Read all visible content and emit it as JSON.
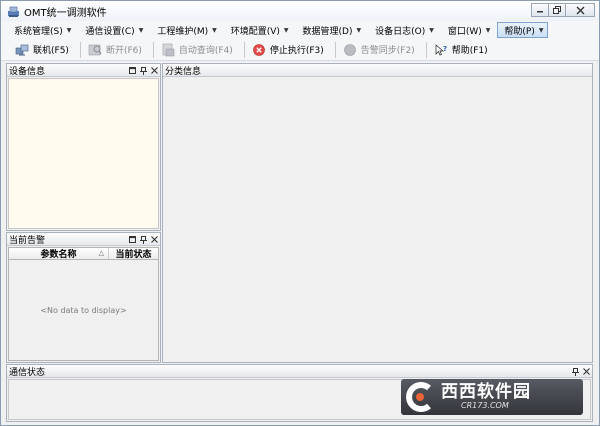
{
  "window": {
    "title": "OMT统一调测软件"
  },
  "menu": [
    {
      "label": "系统管理(S)",
      "active": false
    },
    {
      "label": "通信设置(C)",
      "active": false
    },
    {
      "label": "工程维护(M)",
      "active": false
    },
    {
      "label": "环境配置(V)",
      "active": false
    },
    {
      "label": "数据管理(D)",
      "active": false
    },
    {
      "label": "设备日志(O)",
      "active": false
    },
    {
      "label": "窗口(W)",
      "active": false
    },
    {
      "label": "帮助(P)",
      "active": true
    }
  ],
  "toolbar": {
    "connect": "联机(F5)",
    "disconnect": "断开(F6)",
    "auto_query": "自动查询(F4)",
    "stop_exec": "停止执行(F3)",
    "alarm_sync": "告警同步(F2)",
    "help": "帮助(F1)"
  },
  "panels": {
    "device_info": "设备信息",
    "class_info": "分类信息",
    "current_alarm": "当前告警",
    "comm_status": "通信状态"
  },
  "alarm_grid": {
    "columns": [
      "参数名称",
      "当前状态"
    ],
    "empty_text": "<No data to display>"
  },
  "watermark": {
    "brand": "西西软件园",
    "site": "CR173.COM"
  }
}
